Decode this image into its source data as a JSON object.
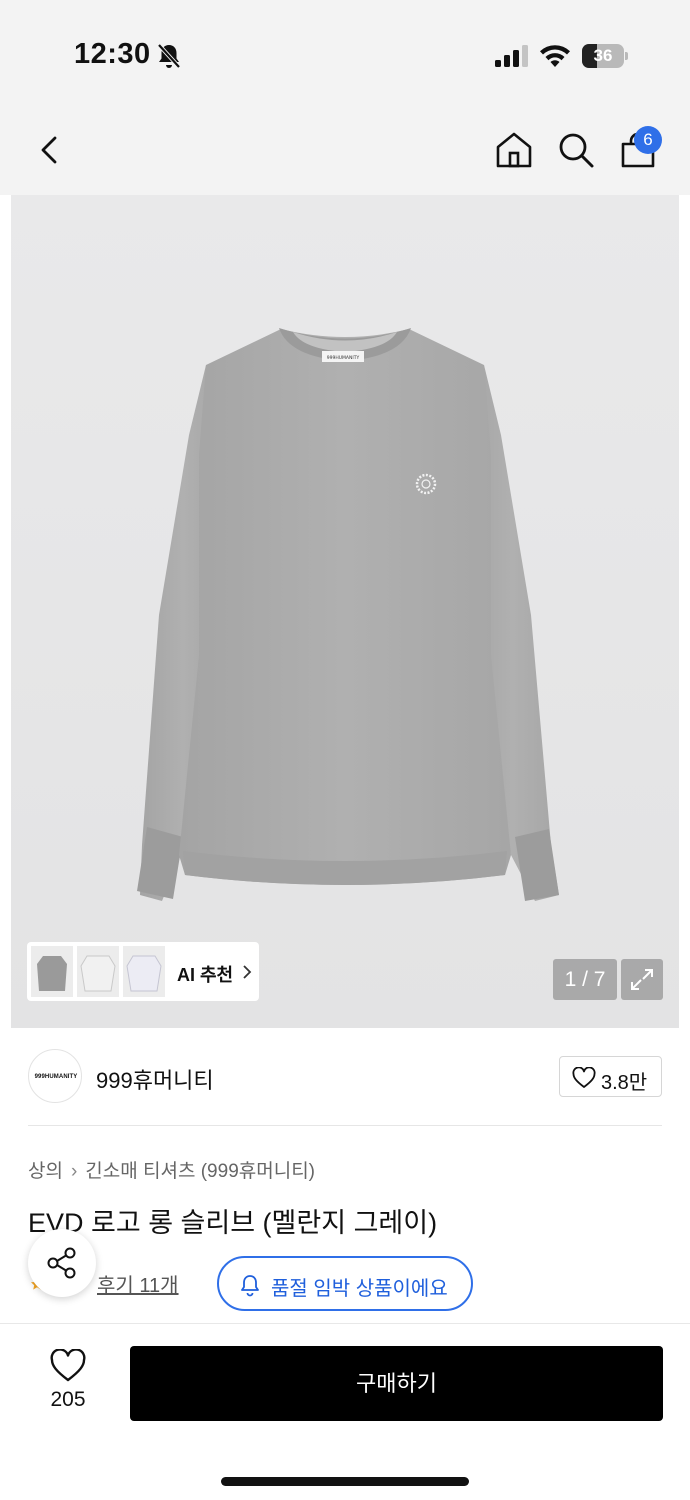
{
  "status_bar": {
    "time": "12:30",
    "battery_level": "36",
    "battery_fraction": 0.36,
    "icons": [
      "bell-off-icon",
      "cellular-signal-icon",
      "wifi-icon",
      "battery-icon"
    ]
  },
  "nav": {
    "cart_count": "6",
    "icons": [
      "back-icon",
      "home-icon",
      "search-icon",
      "shopping-bag-icon"
    ]
  },
  "gallery": {
    "shirt_brand_label": "999HUMANITY",
    "ai_recommend_label": "AI 추천",
    "page_counter": "1 / 7",
    "thumbnail_count": 3
  },
  "brand": {
    "logo_text": "999HUMANITY",
    "name": "999휴머니티",
    "like_count": "3.8만"
  },
  "product": {
    "breadcrumb": [
      "상의",
      "긴소매 티셔츠 (999휴머니티)"
    ],
    "title": "EVD 로고 롱 슬리브 (멜란지 그레이)",
    "review_label": "후기 11개",
    "stock_notice": "품절 임박 상품이에요"
  },
  "bottom_bar": {
    "wish_count": "205",
    "buy_label": "구매하기"
  },
  "colors": {
    "accent_blue": "#2f6fe8",
    "buy_button": "#000000",
    "image_bg": "#e6e6e7"
  }
}
